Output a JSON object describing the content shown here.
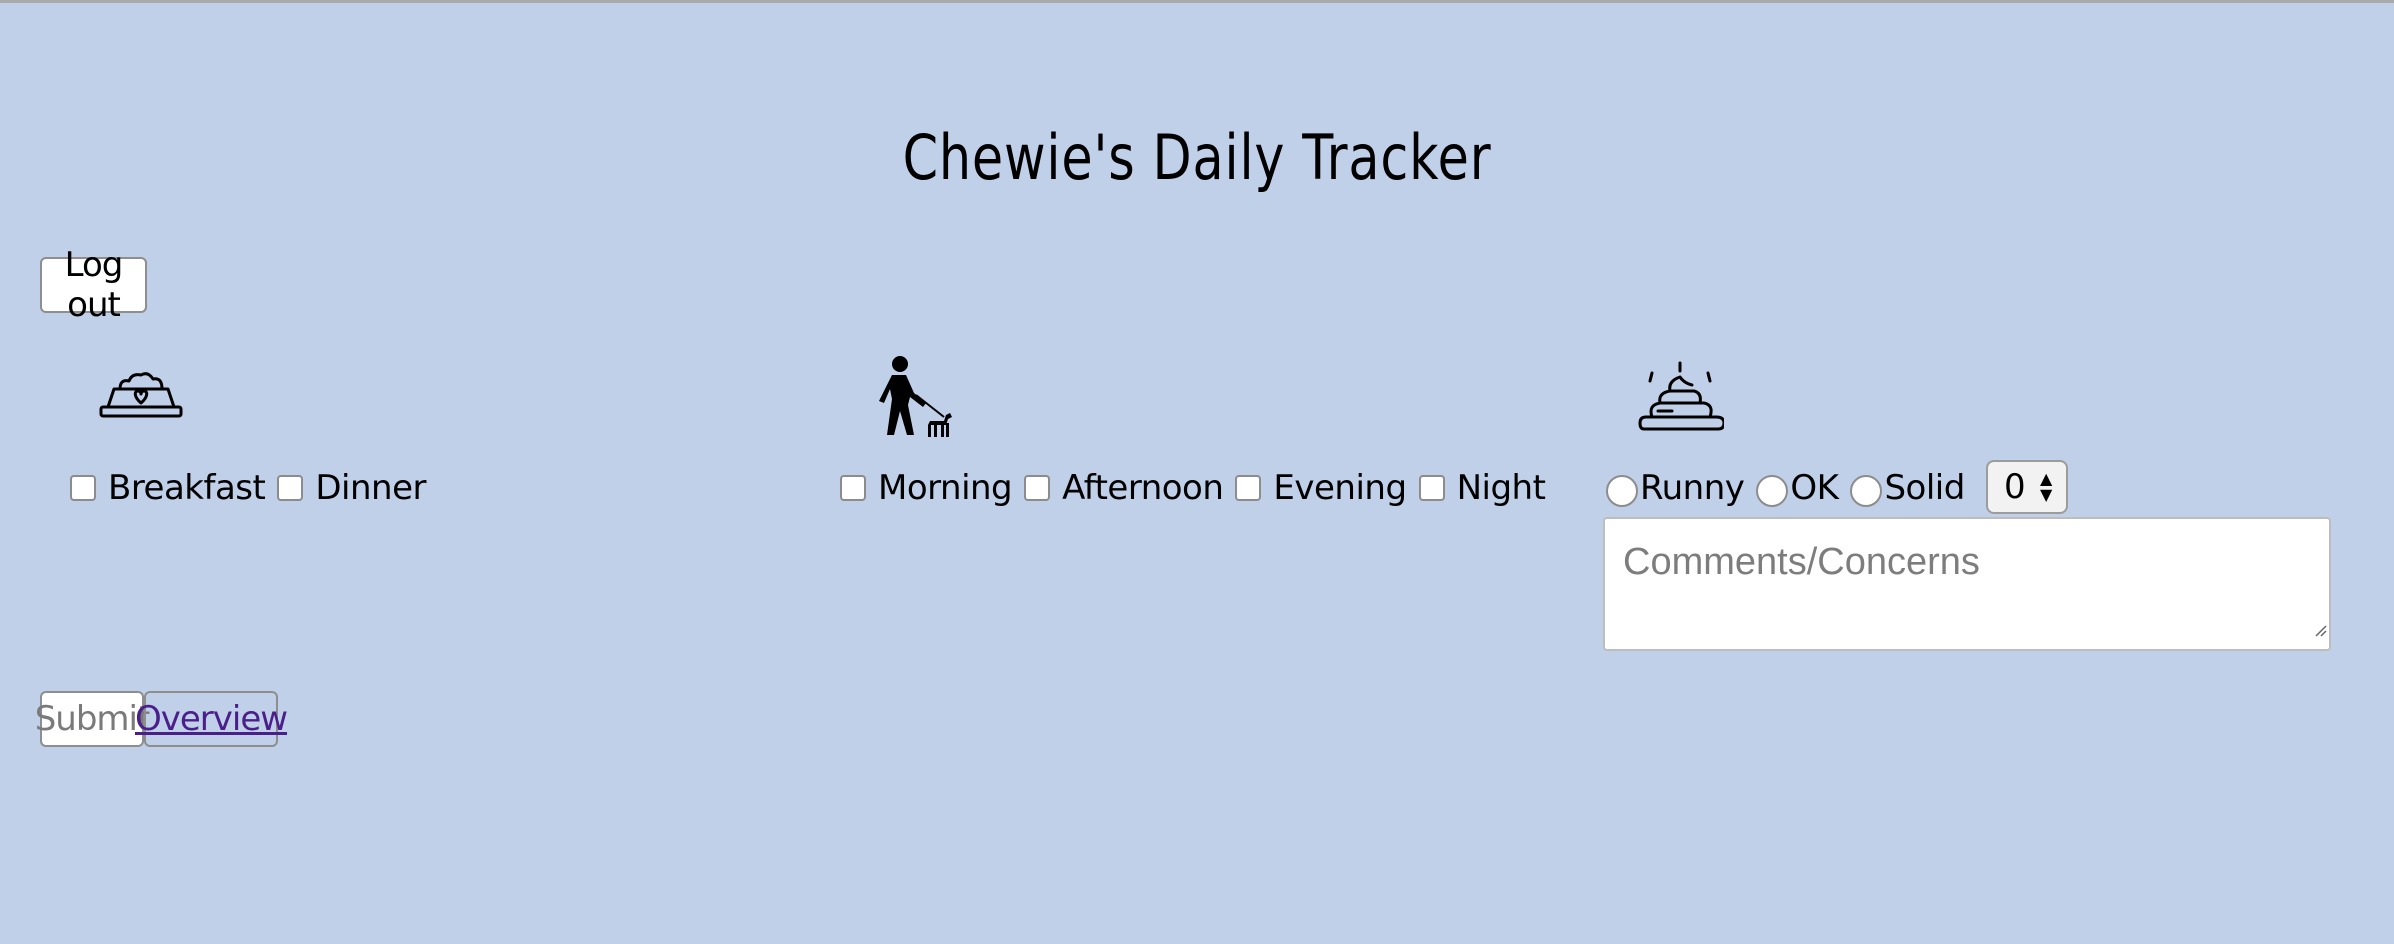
{
  "page": {
    "title": "Chewie's Daily Tracker"
  },
  "buttons": {
    "logout": "Log out",
    "submit": "Submit",
    "overview": "Overview"
  },
  "meals": {
    "icon": "food-bowl-icon",
    "options": [
      "Breakfast",
      "Dinner"
    ]
  },
  "walks": {
    "icon": "dog-walking-icon",
    "options": [
      "Morning",
      "Afternoon",
      "Evening",
      "Night"
    ]
  },
  "poop": {
    "icon": "poop-icon",
    "options": [
      "Runny",
      "OK",
      "Solid"
    ],
    "count": "0"
  },
  "comments": {
    "placeholder": "Comments/Concerns"
  },
  "colors": {
    "background": "#bfd0e8",
    "link": "#4b1f8a"
  }
}
